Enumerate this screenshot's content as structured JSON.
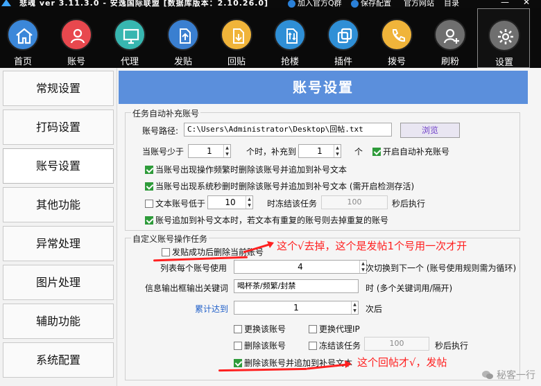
{
  "app": {
    "title": "悲魂 ver 3.11.3.0 - 安逸国际联盟 [数据库版本：2.10.26.0]",
    "links": {
      "join_group": "加入官方Q群",
      "save_config": "保存配置",
      "official_site": "官方网站",
      "directory": "目录"
    },
    "window_controls": {
      "minimize": "—",
      "close": "✕"
    }
  },
  "toolbar": [
    {
      "label": "首页",
      "icon": "home-icon",
      "color": "#3b87d9"
    },
    {
      "label": "账号",
      "icon": "user-icon",
      "color": "#e8484e"
    },
    {
      "label": "代理",
      "icon": "monitor-icon",
      "color": "#37b6b0"
    },
    {
      "label": "发贴",
      "icon": "upload-icon",
      "color": "#3a7fd0"
    },
    {
      "label": "回贴",
      "icon": "download-icon",
      "color": "#f0b43a"
    },
    {
      "label": "抢楼",
      "icon": "transfer-icon",
      "color": "#2f8fd6"
    },
    {
      "label": "插件",
      "icon": "copy-icon",
      "color": "#2f8fd6"
    },
    {
      "label": "拨号",
      "icon": "phone-icon",
      "color": "#f0b43a"
    },
    {
      "label": "刷粉",
      "icon": "add-user-icon",
      "color": "#6f6f6f"
    },
    {
      "label": "设置",
      "icon": "gear-icon",
      "color": "#6f6f6f"
    }
  ],
  "sidebar": {
    "items": [
      "常规设置",
      "打码设置",
      "账号设置",
      "其他功能",
      "异常处理",
      "图片处理",
      "辅助功能",
      "系统配置"
    ],
    "selected": "账号设置"
  },
  "main": {
    "header": "账号设置",
    "auto_group": {
      "title": "任务自动补充账号",
      "path_label": "账号路径:",
      "path_value": "C:\\Users\\Administrator\\Desktop\\回帖.txt",
      "browse": "浏览",
      "less_than_label": "当账号少于",
      "less_than_value": "1",
      "when_label": "个时，补充到",
      "fill_to_value": "1",
      "unit": "个",
      "auto_fill": {
        "label": "开启自动补充账号",
        "checked": true
      },
      "freq_delete": {
        "label": "当账号出现操作频繁时删除该账号并追加到补号文本",
        "checked": true
      },
      "seckill_delete": {
        "label": "当账号出现系统秒删时删除该账号并追加到补号文本 (需开启检测存活)",
        "checked": true
      },
      "text_below": {
        "label": "文本账号低于",
        "checked": false
      },
      "text_below_value": "10",
      "freeze_label": "时冻结该任务",
      "freeze_value": "100",
      "seconds_label": "秒后执行",
      "dedupe": {
        "label": "账号追加到补号文本时，若文本有重复的账号则去掉重复的账号",
        "checked": true
      }
    },
    "custom_group": {
      "title": "自定义账号操作任务",
      "delete_after_post": {
        "label": "发贴成功后删除当前账号",
        "checked": false
      },
      "per_account_label": "列表每个账号使用",
      "per_account_value": "4",
      "switch_label": "次切换到下一个 (账号使用规则需为循环)",
      "keyword_label": "信息输出框输出关键词",
      "keyword_value": "喝杯茶/频繁/封禁",
      "keyword_hint": "时 (多个关键词用/隔开)",
      "accumulate_label": "累计达到",
      "accumulate_value": "1",
      "after_label": "次后",
      "change_account": {
        "label": "更换该账号",
        "checked": false
      },
      "change_proxy": {
        "label": "更换代理IP",
        "checked": false
      },
      "delete_account": {
        "label": "删除该账号",
        "checked": false
      },
      "freeze_task": {
        "label": "冻结该任务",
        "checked": false
      },
      "freeze_task_value": "100",
      "freeze_task_seconds": "秒后执行",
      "delete_append": {
        "label": "删除该账号并追加到补号文本",
        "checked": true
      }
    },
    "annotations": {
      "note1": "这个√去掉，这个是发帖1个号用一次才开",
      "note2": "这个回帖才√，发帖"
    }
  },
  "watermark": "秘客一行"
}
